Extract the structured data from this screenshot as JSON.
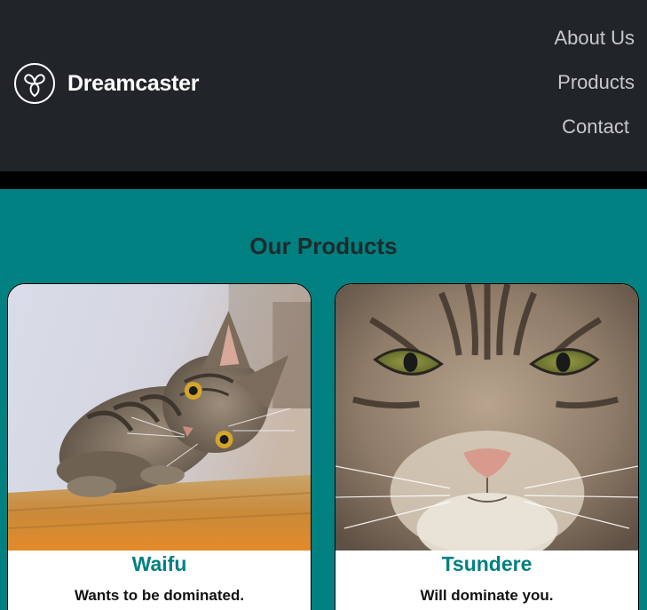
{
  "brand": {
    "name": "Dreamcaster",
    "logo_icon": "triple-heart-circle-icon"
  },
  "nav": {
    "links": [
      {
        "label": "About Us"
      },
      {
        "label": "Products"
      },
      {
        "label": "Contact"
      }
    ]
  },
  "colors": {
    "navbar": "#212529",
    "accent": "#008080",
    "page_bg": "#008080",
    "nav_link": "#c7c9cb"
  },
  "products": {
    "title": "Our Products",
    "items": [
      {
        "name": "Waifu",
        "description": "Wants to be dominated.",
        "image": "tabby-cat-lying-on-table-photo"
      },
      {
        "name": "Tsundere",
        "description": "Will dominate you.",
        "image": "tabby-cat-face-closeup-photo"
      }
    ]
  }
}
